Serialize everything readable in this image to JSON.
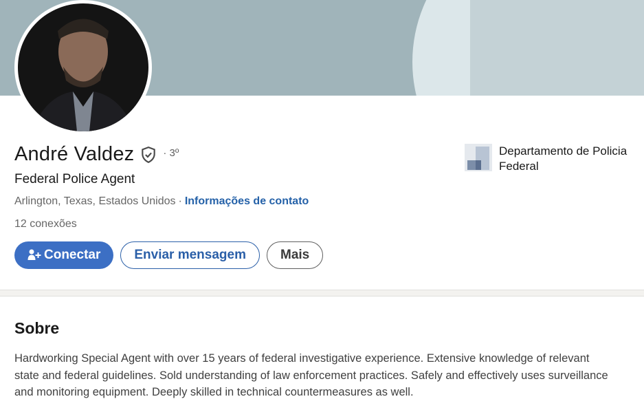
{
  "profile": {
    "name": "André Valdez",
    "degree": "· 3º",
    "headline": "Federal Police Agent",
    "location": "Arlington, Texas, Estados Unidos",
    "location_separator": "·",
    "contact_link": "Informações de contato",
    "connections": "12 conexões",
    "verified_icon": "shield-check-icon"
  },
  "actions": {
    "connect_label": "Conectar",
    "connect_icon": "person-add-icon",
    "message_label": "Enviar mensagem",
    "more_label": "Mais"
  },
  "company": {
    "name": "Departamento de Policia Federal"
  },
  "about": {
    "title": "Sobre",
    "text": "Hardworking Special Agent with over 15 years of federal investigative experience. Extensive knowledge of relevant state and federal guidelines. Sold understanding of law enforcement practices. Safely and effectively uses surveillance and monitoring equipment. Deeply skilled in technical countermeasures as well."
  },
  "colors": {
    "primary": "#3c6fc4",
    "link": "#2461a8",
    "banner": "#a0b4ba"
  }
}
